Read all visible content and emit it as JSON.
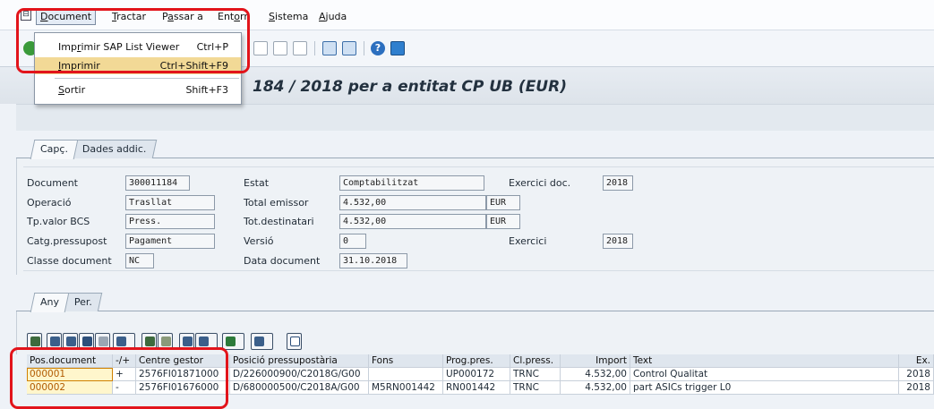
{
  "menubar": {
    "items": [
      {
        "label": "Document",
        "underline": "D",
        "rest": "ocument"
      },
      {
        "label": "Tractar",
        "underline": "T",
        "rest": "ractar"
      },
      {
        "label": "Passar a",
        "pre": "P",
        "underline": "a",
        "rest": "ssar a"
      },
      {
        "label": "Entorn",
        "pre": "Ent",
        "underline": "o",
        "rest": "rn"
      },
      {
        "label": "Sistema",
        "underline": "S",
        "rest": "istema"
      },
      {
        "label": "Ajuda",
        "underline": "A",
        "rest": "juda"
      }
    ]
  },
  "dropdown": {
    "items": [
      {
        "pre": "Imp",
        "underline": "r",
        "rest": "imir SAP List Viewer",
        "shortcut": "Ctrl+P"
      },
      {
        "pre": "",
        "underline": "I",
        "rest": "mprimir",
        "shortcut": "Ctrl+Shift+F9"
      },
      {
        "pre": "",
        "underline": "S",
        "rest": "ortir",
        "shortcut": "Shift+F3"
      }
    ]
  },
  "title": "184 / 2018 per a entitat CP UB (EUR)",
  "header_tabs": [
    "Capç.",
    "Dades addic."
  ],
  "fields": {
    "document": {
      "label": "Document",
      "value": "300011184"
    },
    "operacio": {
      "label": "Operació",
      "value": "Trasllat"
    },
    "tp_valor": {
      "label": "Tp.valor BCS",
      "value": "Press."
    },
    "catg": {
      "label": "Catg.pressupost",
      "value": "Pagament"
    },
    "classe": {
      "label": "Classe document",
      "value": "NC"
    },
    "estat": {
      "label": "Estat",
      "value": "Comptabilitzat"
    },
    "total_emissor": {
      "label": "Total emissor",
      "value": "4.532,00",
      "currency": "EUR"
    },
    "tot_dest": {
      "label": "Tot.destinatari",
      "value": "4.532,00",
      "currency": "EUR"
    },
    "versio": {
      "label": "Versió",
      "value": "0"
    },
    "data_doc": {
      "label": "Data document",
      "value": "31.10.2018"
    },
    "exercici_doc": {
      "label": "Exercici doc.",
      "value": "2018"
    },
    "exercici": {
      "label": "Exercici",
      "value": "2018"
    }
  },
  "item_tabs": [
    "Any",
    "Per."
  ],
  "grid": {
    "columns": [
      "Pos.document",
      "-/+",
      "Centre gestor",
      "Posició pressupostària",
      "Fons",
      "Prog.pres.",
      "Cl.press.",
      "Import",
      "Text",
      "Ex."
    ],
    "rows": [
      [
        "000001",
        "+",
        "2576FI01871000",
        "D/226000900/C2018G/G00",
        "",
        "UP000172",
        "TRNC",
        "4.532,00",
        "Control Qualitat",
        "2018"
      ],
      [
        "000002",
        "-",
        "2576FI01676000",
        "D/680000500/C2018A/G00",
        "M5RN001442",
        "RN001442",
        "TRNC",
        "4.532,00",
        "part ASICs trigger L0",
        "2018"
      ]
    ]
  }
}
